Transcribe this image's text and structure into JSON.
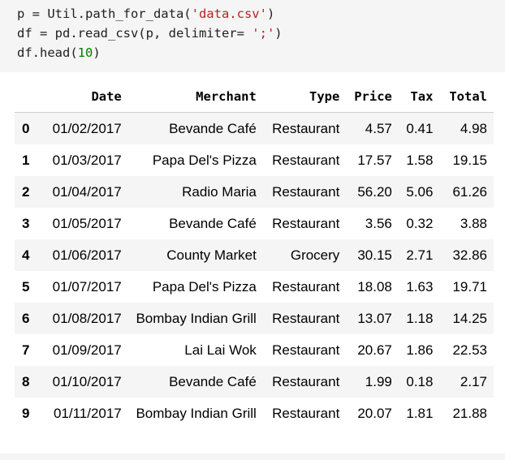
{
  "code": {
    "line1": {
      "pre": "p = Util.path_for_data(",
      "str": "'data.csv'",
      "post": ")"
    },
    "line2": {
      "pre": "df = pd.read_csv(p, delimiter= ",
      "str": "';'",
      "post": ")"
    },
    "line3": {
      "pre": "df.head(",
      "num": "10",
      "post": ")"
    }
  },
  "table": {
    "headers": [
      "",
      "Date",
      "Merchant",
      "Type",
      "Price",
      "Tax",
      "Total"
    ],
    "rows": [
      [
        "0",
        "01/02/2017",
        "Bevande Café",
        "Restaurant",
        "4.57",
        "0.41",
        "4.98"
      ],
      [
        "1",
        "01/03/2017",
        "Papa Del's Pizza",
        "Restaurant",
        "17.57",
        "1.58",
        "19.15"
      ],
      [
        "2",
        "01/04/2017",
        "Radio Maria",
        "Restaurant",
        "56.20",
        "5.06",
        "61.26"
      ],
      [
        "3",
        "01/05/2017",
        "Bevande Café",
        "Restaurant",
        "3.56",
        "0.32",
        "3.88"
      ],
      [
        "4",
        "01/06/2017",
        "County Market",
        "Grocery",
        "30.15",
        "2.71",
        "32.86"
      ],
      [
        "5",
        "01/07/2017",
        "Papa Del's Pizza",
        "Restaurant",
        "18.08",
        "1.63",
        "19.71"
      ],
      [
        "6",
        "01/08/2017",
        "Bombay Indian Grill",
        "Restaurant",
        "13.07",
        "1.18",
        "14.25"
      ],
      [
        "7",
        "01/09/2017",
        "Lai Lai Wok",
        "Restaurant",
        "20.67",
        "1.86",
        "22.53"
      ],
      [
        "8",
        "01/10/2017",
        "Bevande Café",
        "Restaurant",
        "1.99",
        "0.18",
        "2.17"
      ],
      [
        "9",
        "01/11/2017",
        "Bombay Indian Grill",
        "Restaurant",
        "20.07",
        "1.81",
        "21.88"
      ]
    ]
  }
}
